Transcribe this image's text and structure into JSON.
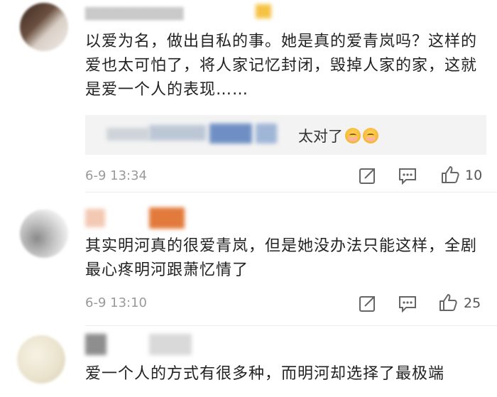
{
  "comments": [
    {
      "body": "以爱为名，做出自私的事。她是真的爱青岚吗？这样的爱也太可怕了，将人家记忆封闭，毁掉人家的家，这就是爱一个人的表现……",
      "reply": {
        "text": "太对了",
        "emoji": [
          "crying-face-icon",
          "crying-face-icon"
        ]
      },
      "time": "6-9 13:34",
      "likes": "10"
    },
    {
      "body": "其实明河真的很爱青岚，但是她没办法只能这样，全剧最心疼明河跟萧忆情了",
      "time": "6-9 13:10",
      "likes": "25"
    },
    {
      "body": "爱一个人的方式有很多种，而明河却选择了最极端"
    }
  ],
  "icons": {
    "share": "share-icon",
    "comment": "comment-icon",
    "like": "thumbs-up-icon"
  },
  "colors": {
    "text": "#222222",
    "meta": "#9a9a9a",
    "reply_bg": "#f3f3f3"
  }
}
